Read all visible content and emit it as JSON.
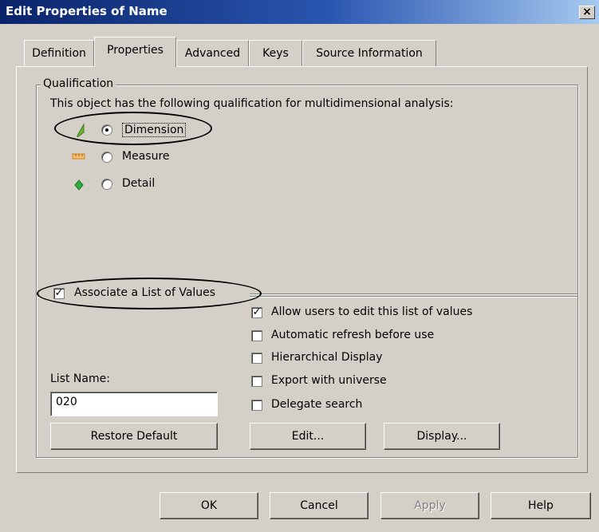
{
  "window": {
    "title": "Edit Properties of Name",
    "close_glyph": "×"
  },
  "tabs": [
    {
      "label": "Definition"
    },
    {
      "label": "Properties"
    },
    {
      "label": "Advanced"
    },
    {
      "label": "Keys"
    },
    {
      "label": "Source Information"
    }
  ],
  "active_tab": "Properties",
  "qualification": {
    "legend": "Qualification",
    "description": "This object has the following qualification for multidimensional analysis:",
    "options": [
      {
        "label": "Dimension",
        "selected": true,
        "icon": "dimension-icon"
      },
      {
        "label": "Measure",
        "selected": false,
        "icon": "measure-icon"
      },
      {
        "label": "Detail",
        "selected": false,
        "icon": "detail-icon"
      }
    ]
  },
  "lov": {
    "associate_label": "Associate a List of Values",
    "associate_checked": true,
    "options": [
      {
        "label": "Allow users to edit this list of values",
        "checked": true
      },
      {
        "label": "Automatic refresh before use",
        "checked": false
      },
      {
        "label": "Hierarchical Display",
        "checked": false
      },
      {
        "label": "Export with universe",
        "checked": false
      },
      {
        "label": "Delegate search",
        "checked": false
      }
    ],
    "list_name_label": "List Name:",
    "list_name_value": "020",
    "restore_default_label": "Restore Default",
    "edit_label": "Edit...",
    "display_label": "Display..."
  },
  "footer": {
    "ok_label": "OK",
    "cancel_label": "Cancel",
    "apply_label": "Apply",
    "help_label": "Help"
  },
  "colors": {
    "title_bar_start": "#0a246a",
    "dialog_bg": "#d4d0c8",
    "dimension_green": "#6fb53a",
    "measure_orange": "#e8a040",
    "detail_green": "#2fae3f"
  }
}
